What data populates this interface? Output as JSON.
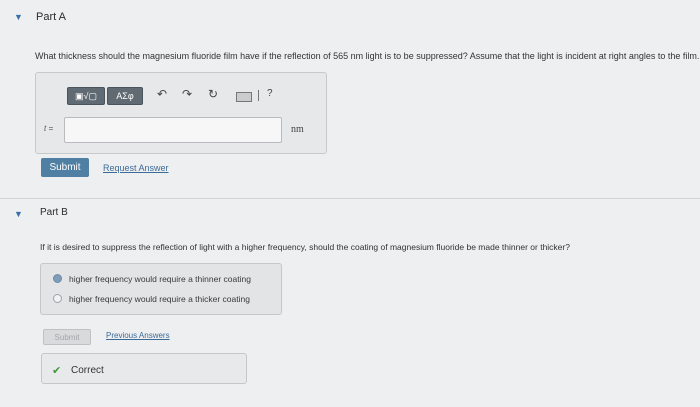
{
  "part_a": {
    "title": "Part A",
    "question": "What thickness should the magnesium fluoride film have if the reflection of 565 nm light is to be suppressed? Assume that the light is incident at right angles to the film.",
    "toolbar": {
      "template_label": "▣√▢",
      "greek_label": "ΑΣφ",
      "help_label": "?"
    },
    "variable_label": "t =",
    "input_value": "",
    "unit": "nm",
    "submit_label": "Submit",
    "request_answer_label": "Request Answer"
  },
  "part_b": {
    "title": "Part B",
    "question": "If it is desired to suppress the reflection of light with a higher frequency, should the coating of magnesium fluoride be made thinner or thicker?",
    "options": [
      {
        "label": "higher frequency would require a thinner coating",
        "selected": true
      },
      {
        "label": "higher frequency would require a thicker coating",
        "selected": false
      }
    ],
    "submit_label": "Submit",
    "previous_answers_label": "Previous Answers",
    "feedback_label": "Correct"
  },
  "colors": {
    "accent": "#4f7fa3",
    "link": "#3d6b99",
    "correct": "#3f9a3a",
    "background": "#eeeff0"
  }
}
